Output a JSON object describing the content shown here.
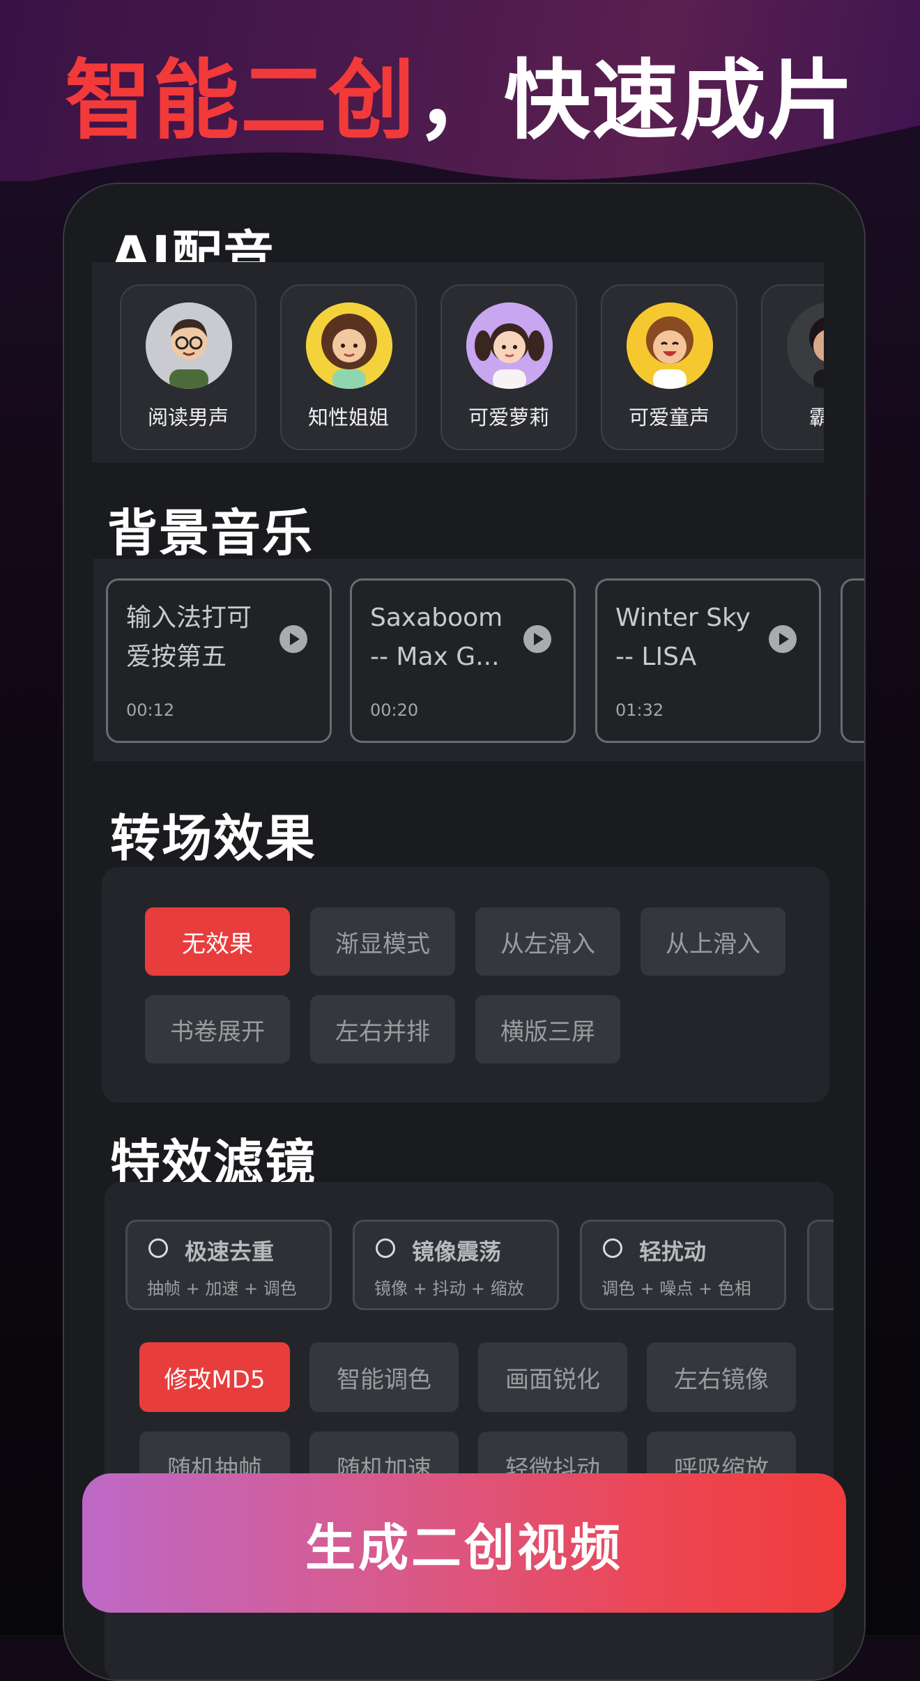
{
  "headline": {
    "red": "智能二创",
    "white": "，快速成片"
  },
  "voice": {
    "title": "AI配音",
    "items": [
      {
        "label": "阅读男声",
        "avatar": "glasses-man-avatar",
        "bg": "#c9cbd0"
      },
      {
        "label": "知性姐姐",
        "avatar": "curly-woman-avatar",
        "bg": "#f4d23c"
      },
      {
        "label": "可爱萝莉",
        "avatar": "pigtails-girl-avatar",
        "bg": "#c8a6f0"
      },
      {
        "label": "可爱童声",
        "avatar": "laughing-kid-avatar",
        "bg": "#f6c830"
      },
      {
        "label": "霸道",
        "avatar": "man-dark-avatar",
        "bg": "#3a3c40"
      }
    ]
  },
  "music": {
    "title": "背景音乐",
    "items": [
      {
        "title": "输入法打可\n爱按第五",
        "time": "00:12"
      },
      {
        "title": "Saxaboom\n-- Max G...",
        "time": "00:20"
      },
      {
        "title": "Winter Sky\n-- LISA",
        "time": "01:32"
      }
    ]
  },
  "transition": {
    "title": "转场效果",
    "options": [
      "无效果",
      "渐显模式",
      "从左滑入",
      "从上滑入",
      "书卷展开",
      "左右并排",
      "横版三屏"
    ],
    "selected": "无效果"
  },
  "filter": {
    "title": "特效滤镜",
    "presets": [
      {
        "name": "极速去重",
        "desc": "抽帧 + 加速 + 调色"
      },
      {
        "name": "镜像震荡",
        "desc": "镜像 + 抖动 + 缩放"
      },
      {
        "name": "轻扰动",
        "desc": "调色 + 噪点 + 色相"
      }
    ],
    "options": [
      "修改MD5",
      "智能调色",
      "画面锐化",
      "左右镜像",
      "随机抽帧",
      "随机加速",
      "轻微抖动",
      "呼吸缩放"
    ],
    "selected": "修改MD5"
  },
  "cta": {
    "label": "生成二创视频"
  },
  "colors": {
    "accent": "#e83d3d",
    "card_bg": "#23252a"
  }
}
